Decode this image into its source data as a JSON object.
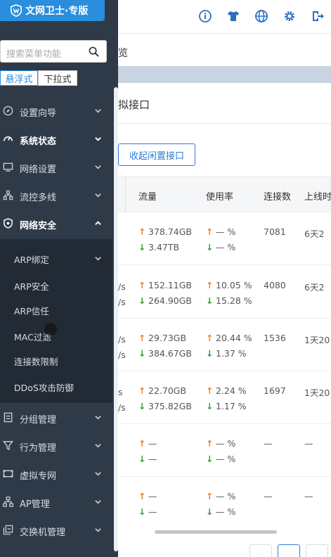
{
  "brand": {
    "title": "文网卫士·专版"
  },
  "search": {
    "placeholder": "搜索菜单功能"
  },
  "menu_mode": {
    "float_label": "悬浮式",
    "dropdown_label": "下拉式"
  },
  "sidebar": {
    "items": [
      {
        "label": "设置向导",
        "icon": "compass-icon"
      },
      {
        "label": "系统状态",
        "icon": "dashboard-icon"
      },
      {
        "label": "网络设置",
        "icon": "monitor-icon"
      },
      {
        "label": "流控多线",
        "icon": "network-icon"
      },
      {
        "label": "网络安全",
        "icon": "shield-icon",
        "expanded": true
      },
      {
        "label": "分组管理",
        "icon": "group-icon"
      },
      {
        "label": "行为管理",
        "icon": "funnel-icon"
      },
      {
        "label": "虚拟专网",
        "icon": "vpn-icon"
      },
      {
        "label": "AP管理",
        "icon": "ap-icon"
      },
      {
        "label": "交换机管理",
        "icon": "switch-icon"
      }
    ],
    "security_submenu": [
      "ARP绑定",
      "ARP安全",
      "ARP信任",
      "MAC过滤",
      "连接数限制",
      "DDoS攻击防御"
    ]
  },
  "main": {
    "tab_label": "览",
    "card_title": "拟接口",
    "collapse_button": "收起闲置接口",
    "table": {
      "headers": [
        "流量",
        "使用率",
        "连接数",
        "上线时"
      ],
      "rows": [
        {
          "prefix_up": "",
          "prefix_down": "",
          "traffic_up": "378.74GB",
          "traffic_down": "3.47TB",
          "usage_up": "— %",
          "usage_down": "— %",
          "conn": "7081",
          "online": "6天2"
        },
        {
          "prefix_up": "/s",
          "prefix_down": "/s",
          "traffic_up": "152.11GB",
          "traffic_down": "264.90GB",
          "usage_up": "10.05 %",
          "usage_down": "15.28 %",
          "conn": "4080",
          "online": "6天2"
        },
        {
          "prefix_up": "/s",
          "prefix_down": "/s",
          "traffic_up": "29.73GB",
          "traffic_down": "384.67GB",
          "usage_up": "20.44 %",
          "usage_down": "1.37 %",
          "conn": "1536",
          "online": "1天20"
        },
        {
          "prefix_up": "s",
          "prefix_down": "/s",
          "traffic_up": "22.70GB",
          "traffic_down": "375.82GB",
          "usage_up": "2.24 %",
          "usage_down": "1.17 %",
          "conn": "1697",
          "online": "1天20"
        },
        {
          "prefix_up": "",
          "prefix_down": "",
          "traffic_up": "—",
          "traffic_down": "—",
          "usage_up": "— %",
          "usage_down": "— %",
          "conn": "—",
          "online": "—"
        },
        {
          "prefix_up": "",
          "prefix_down": "",
          "traffic_up": "—",
          "traffic_down": "—",
          "usage_up": "— %",
          "usage_down": "— %",
          "conn": "—",
          "online": "—"
        }
      ]
    }
  },
  "colors": {
    "brand": "#2a8dde",
    "sidebar_bg": "#2f3a48",
    "submenu_bg": "#212a35",
    "up_arrow": "#e8832a",
    "down_arrow": "#3a9a3a",
    "accent": "#2e7bd6"
  }
}
